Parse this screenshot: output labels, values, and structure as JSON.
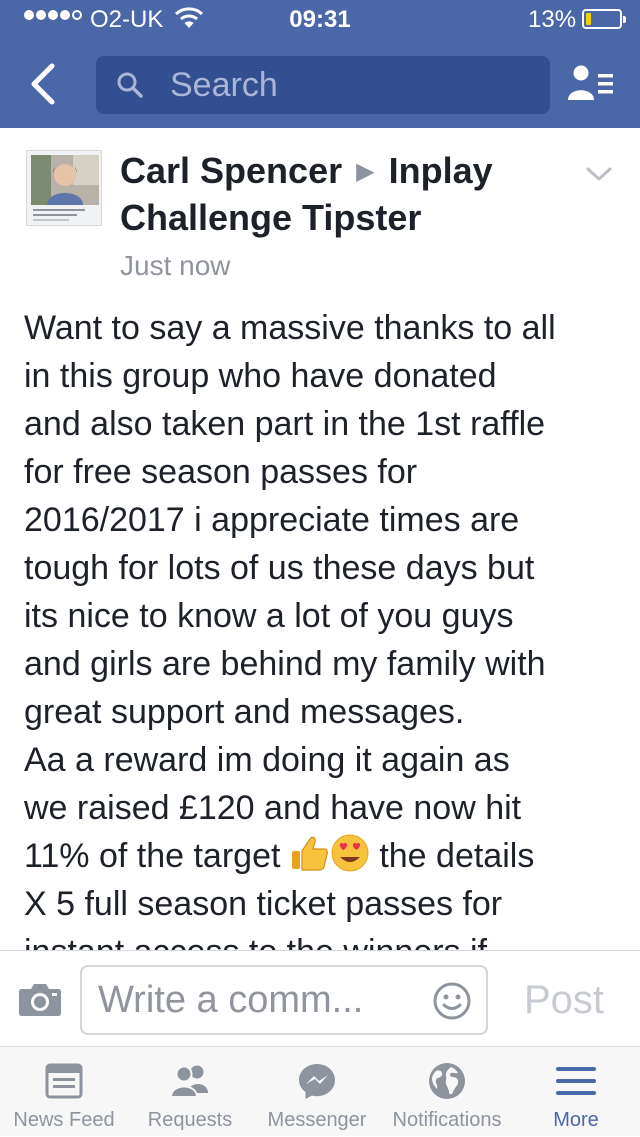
{
  "status_bar": {
    "carrier": "O2-UK",
    "time": "09:31",
    "battery_percent": "13%",
    "battery_level": 0.13,
    "signal_bars": 4,
    "signal_max": 5
  },
  "nav": {
    "search_placeholder": "Search",
    "icons": [
      "back-chevron-icon",
      "search-icon",
      "friends-list-icon"
    ]
  },
  "post": {
    "author": "Carl Spencer",
    "separator": "▶",
    "group": "Inplay Challenge Tipster",
    "timestamp": "Just now",
    "body_lines": [
      "Want to say a massive thanks to all",
      "in this group who have donated",
      "and also taken part in the 1st raffle",
      "for free season passes for",
      "2016/2017 i appreciate times are",
      "tough for lots of us these days but",
      "its nice to know a lot of you guys",
      "and girls are behind my family with",
      "great support and messages.",
      "Aa a reward im doing it again as",
      "we raised £120 and have now hit"
    ],
    "line12_before_emoji": "11% of the target ",
    "line12_after_emoji": " the details",
    "line13": "X 5 full season ticket passes for",
    "line14_partial": "instant access to the winners if",
    "emojis": [
      "thumbs-up-icon",
      "heart-eyes-icon"
    ]
  },
  "comment": {
    "placeholder": "Write a comm...",
    "post_label": "Post"
  },
  "tabs": [
    {
      "label": "News Feed",
      "icon": "news-feed-icon",
      "active": false
    },
    {
      "label": "Requests",
      "icon": "requests-icon",
      "active": false
    },
    {
      "label": "Messenger",
      "icon": "messenger-icon",
      "active": false
    },
    {
      "label": "Notifications",
      "icon": "notifications-globe-icon",
      "active": false
    },
    {
      "label": "More",
      "icon": "more-menu-icon",
      "active": true
    }
  ],
  "colors": {
    "brand_blue": "#4a67a8",
    "search_field": "#324f90",
    "active_tab": "#4a67a8",
    "inactive_tab": "#8d949e",
    "battery_fill": "#f5d000"
  }
}
